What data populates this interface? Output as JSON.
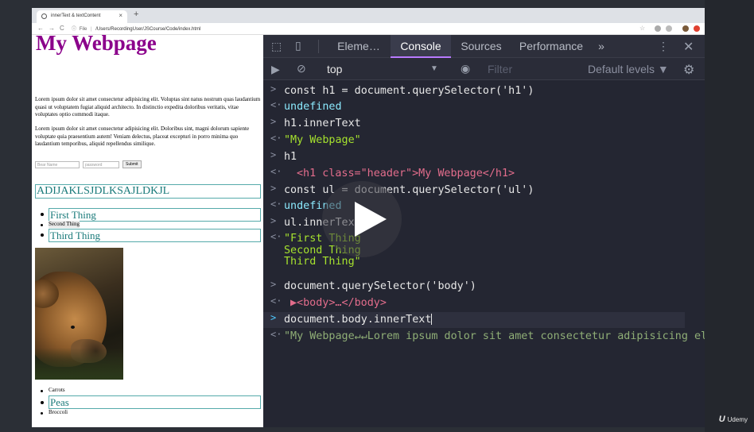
{
  "browser": {
    "tab_title": "innerText & textContent",
    "new_tab_icon": "+",
    "close_icon": "×",
    "url_info": "ⓘ",
    "url_scheme": "File",
    "url_sep": "|",
    "url": "/Users/RecordingUser/JSCourse/Code/index.html"
  },
  "page": {
    "title": "My Webpage",
    "para1": "Lorem ipsum dolor sit amet consectetur adipisicing elit. Voluptas sint natus nostrum quas laudantium quasi ut voluptatem fugiat aliquid architecto. In distinctio expedita doloribus veritatis, vitae voluptates optio commodi itaque.",
    "para2": "Lorem ipsum dolor sit amet consectetur adipisicing elit. Doloribus sint, magni dolorum sapiente voluptate quia praesentium autem! Veniam delectus, placeat excepturi in porro minima quo laudantium temporibus, aliquid repellendus similique.",
    "form": {
      "bear_name_placeholder": "Bear Name",
      "password_placeholder": "password",
      "submit_label": "Submit"
    },
    "h2": "ADIJAKLSJDLKSAJLDKJL",
    "list1": [
      "First Thing",
      "Second Thing",
      "Third Thing"
    ],
    "list2": [
      "Carrots",
      "Peas",
      "Broccoli"
    ]
  },
  "devtools": {
    "tabs": [
      "Eleme…",
      "Console",
      "Sources",
      "Performance",
      "»"
    ],
    "context": "top",
    "filter_placeholder": "Filter",
    "levels": "Default levels ▼",
    "console": [
      {
        "type": "input",
        "text": "const h1 = document.querySelector('h1')"
      },
      {
        "type": "output",
        "text": "undefined"
      },
      {
        "type": "input",
        "text": "h1.innerText"
      },
      {
        "type": "output",
        "text": "\"My Webpage\""
      },
      {
        "type": "input",
        "text": "h1"
      },
      {
        "type": "output",
        "text": "<h1 class=\"header\">My Webpage</h1>"
      },
      {
        "type": "input",
        "text": "const ul = document.querySelector('ul')"
      },
      {
        "type": "output",
        "text": "undefined"
      },
      {
        "type": "input",
        "text": "ul.innerText"
      },
      {
        "type": "output",
        "text": "\"First Thing\nSecond Thing\nThird Thing\""
      },
      {
        "type": "input",
        "text": "document.querySelector('body')"
      },
      {
        "type": "output",
        "text": "▶<body>…</body>"
      },
      {
        "type": "input",
        "text": "document.body.innerText"
      },
      {
        "type": "output",
        "text": "\"My Webpage↵↵Lorem ipsum dolor sit amet consectetur adipisicing elit…"
      }
    ]
  },
  "video": {
    "brand": "Udemy"
  },
  "colors": {
    "title_purple": "#8b008b",
    "teal": "#1a7a7a",
    "console_bg": "#242632",
    "active_tab_accent": "#b97aff"
  }
}
